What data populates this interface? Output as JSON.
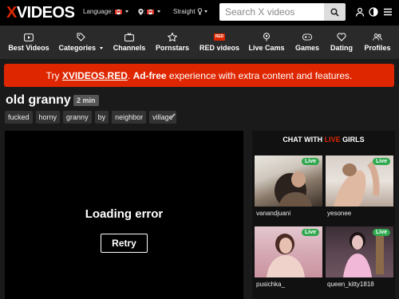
{
  "logo": {
    "x": "X",
    "rest": "VIDEOS"
  },
  "topbar": {
    "language_label": "Language:",
    "country_label": ":",
    "orientation_label": "Straight",
    "search_placeholder": "Search X videos",
    "icons": [
      "search-icon",
      "user-icon",
      "contrast-icon",
      "menu-icon"
    ]
  },
  "nav": [
    {
      "label": "Best Videos",
      "icon": "play-icon"
    },
    {
      "label": "Categories",
      "icon": "tag-icon"
    },
    {
      "label": "Channels",
      "icon": "tv-icon"
    },
    {
      "label": "Pornstars",
      "icon": "star-icon"
    },
    {
      "label": "RED videos",
      "icon": "red-icon",
      "badge": "RED"
    },
    {
      "label": "Live Cams",
      "icon": "location-icon"
    },
    {
      "label": "Games",
      "icon": "gamepad-icon"
    },
    {
      "label": "Dating",
      "icon": "heart-icon"
    },
    {
      "label": "Profiles",
      "icon": "profiles-icon"
    }
  ],
  "banner": {
    "prefix": "Try ",
    "link": "XVIDEOS.RED",
    "dot": ". ",
    "bold": "Ad-free",
    "rest": " experience with extra content and features."
  },
  "video": {
    "title": "old granny",
    "duration": "2 min",
    "tags": [
      "fucked",
      "horny",
      "granny",
      "by",
      "neighbor",
      "village"
    ]
  },
  "player": {
    "error": "Loading error",
    "retry": "Retry"
  },
  "sidebar": {
    "head_prefix": "CHAT WITH ",
    "head_live": "LIVE",
    "head_suffix": " GIRLS",
    "live_badge": "Live",
    "cams": [
      {
        "name": "vanandjuani"
      },
      {
        "name": "yesonee"
      },
      {
        "name": "pusichka_"
      },
      {
        "name": "queen_kitty1818"
      }
    ]
  },
  "colors": {
    "brand_red": "#de2600",
    "live_green": "#2fa84f"
  }
}
